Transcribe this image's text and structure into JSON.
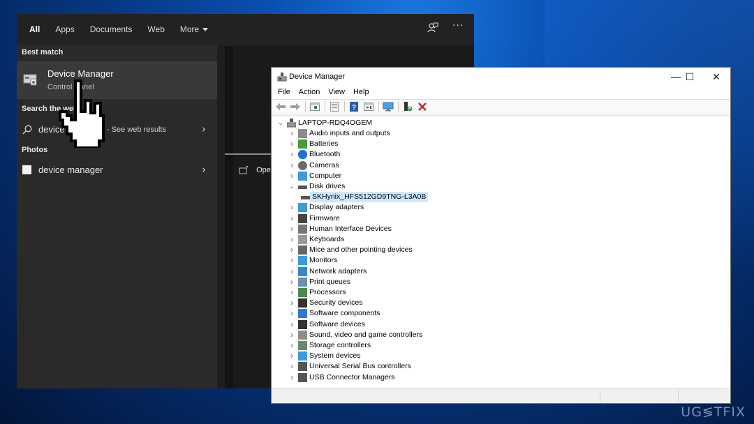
{
  "search": {
    "tabs": [
      {
        "label": "All",
        "active": true
      },
      {
        "label": "Apps",
        "active": false
      },
      {
        "label": "Documents",
        "active": false
      },
      {
        "label": "Web",
        "active": false
      },
      {
        "label": "More",
        "active": false
      }
    ],
    "top_icons": {
      "feedback": "feedback-icon",
      "more": "···"
    },
    "best_match_label": "Best match",
    "best_match": {
      "title": "Device Manager",
      "subtitle": "Control Panel",
      "icon": "device-manager-icon"
    },
    "search_web_label": "Search the web",
    "web_result": {
      "query": "device m",
      "suffix": "- See web results",
      "icon": "search-icon"
    },
    "photos_label": "Photos",
    "photo_result": {
      "label": "device manager",
      "icon": "photo-icon"
    },
    "open_label": "Open",
    "chevron": "›"
  },
  "device_manager": {
    "title": "Device Manager",
    "window_controls": {
      "minimize": "—",
      "maximize": "☐",
      "close": "✕"
    },
    "menu": [
      "File",
      "Action",
      "View",
      "Help"
    ],
    "toolbar": [
      "back",
      "forward",
      "show-hide-console-tree",
      "properties",
      "help",
      "run-action",
      "scan-hardware",
      "update-driver",
      "uninstall-device"
    ],
    "root": "LAPTOP-RDQ4OGEM",
    "tree": [
      {
        "label": "Audio inputs and outputs",
        "expanded": false,
        "icon": "speaker"
      },
      {
        "label": "Batteries",
        "expanded": false,
        "icon": "battery"
      },
      {
        "label": "Bluetooth",
        "expanded": false,
        "icon": "bluetooth"
      },
      {
        "label": "Cameras",
        "expanded": false,
        "icon": "camera"
      },
      {
        "label": "Computer",
        "expanded": false,
        "icon": "monitor"
      },
      {
        "label": "Disk drives",
        "expanded": true,
        "icon": "disk"
      },
      {
        "label": "SKHynix_HFS512GD9TNG-L3A0B",
        "child": true,
        "selected": true,
        "icon": "disk"
      },
      {
        "label": "Display adapters",
        "expanded": false,
        "icon": "display-adapter"
      },
      {
        "label": "Firmware",
        "expanded": false,
        "icon": "chip"
      },
      {
        "label": "Human Interface Devices",
        "expanded": false,
        "icon": "hid"
      },
      {
        "label": "Keyboards",
        "expanded": false,
        "icon": "keyboard"
      },
      {
        "label": "Mice and other pointing devices",
        "expanded": false,
        "icon": "mouse"
      },
      {
        "label": "Monitors",
        "expanded": false,
        "icon": "monitor"
      },
      {
        "label": "Network adapters",
        "expanded": false,
        "icon": "network"
      },
      {
        "label": "Print queues",
        "expanded": false,
        "icon": "printer"
      },
      {
        "label": "Processors",
        "expanded": false,
        "icon": "processor"
      },
      {
        "label": "Security devices",
        "expanded": false,
        "icon": "security"
      },
      {
        "label": "Software components",
        "expanded": false,
        "icon": "software-component"
      },
      {
        "label": "Software devices",
        "expanded": false,
        "icon": "software-device"
      },
      {
        "label": "Sound, video and game controllers",
        "expanded": false,
        "icon": "speaker"
      },
      {
        "label": "Storage controllers",
        "expanded": false,
        "icon": "storage"
      },
      {
        "label": "System devices",
        "expanded": false,
        "icon": "system"
      },
      {
        "label": "Universal Serial Bus controllers",
        "expanded": false,
        "icon": "usb"
      },
      {
        "label": "USB Connector Managers",
        "expanded": false,
        "icon": "usb"
      }
    ]
  },
  "watermark": "UG≶TFIX"
}
